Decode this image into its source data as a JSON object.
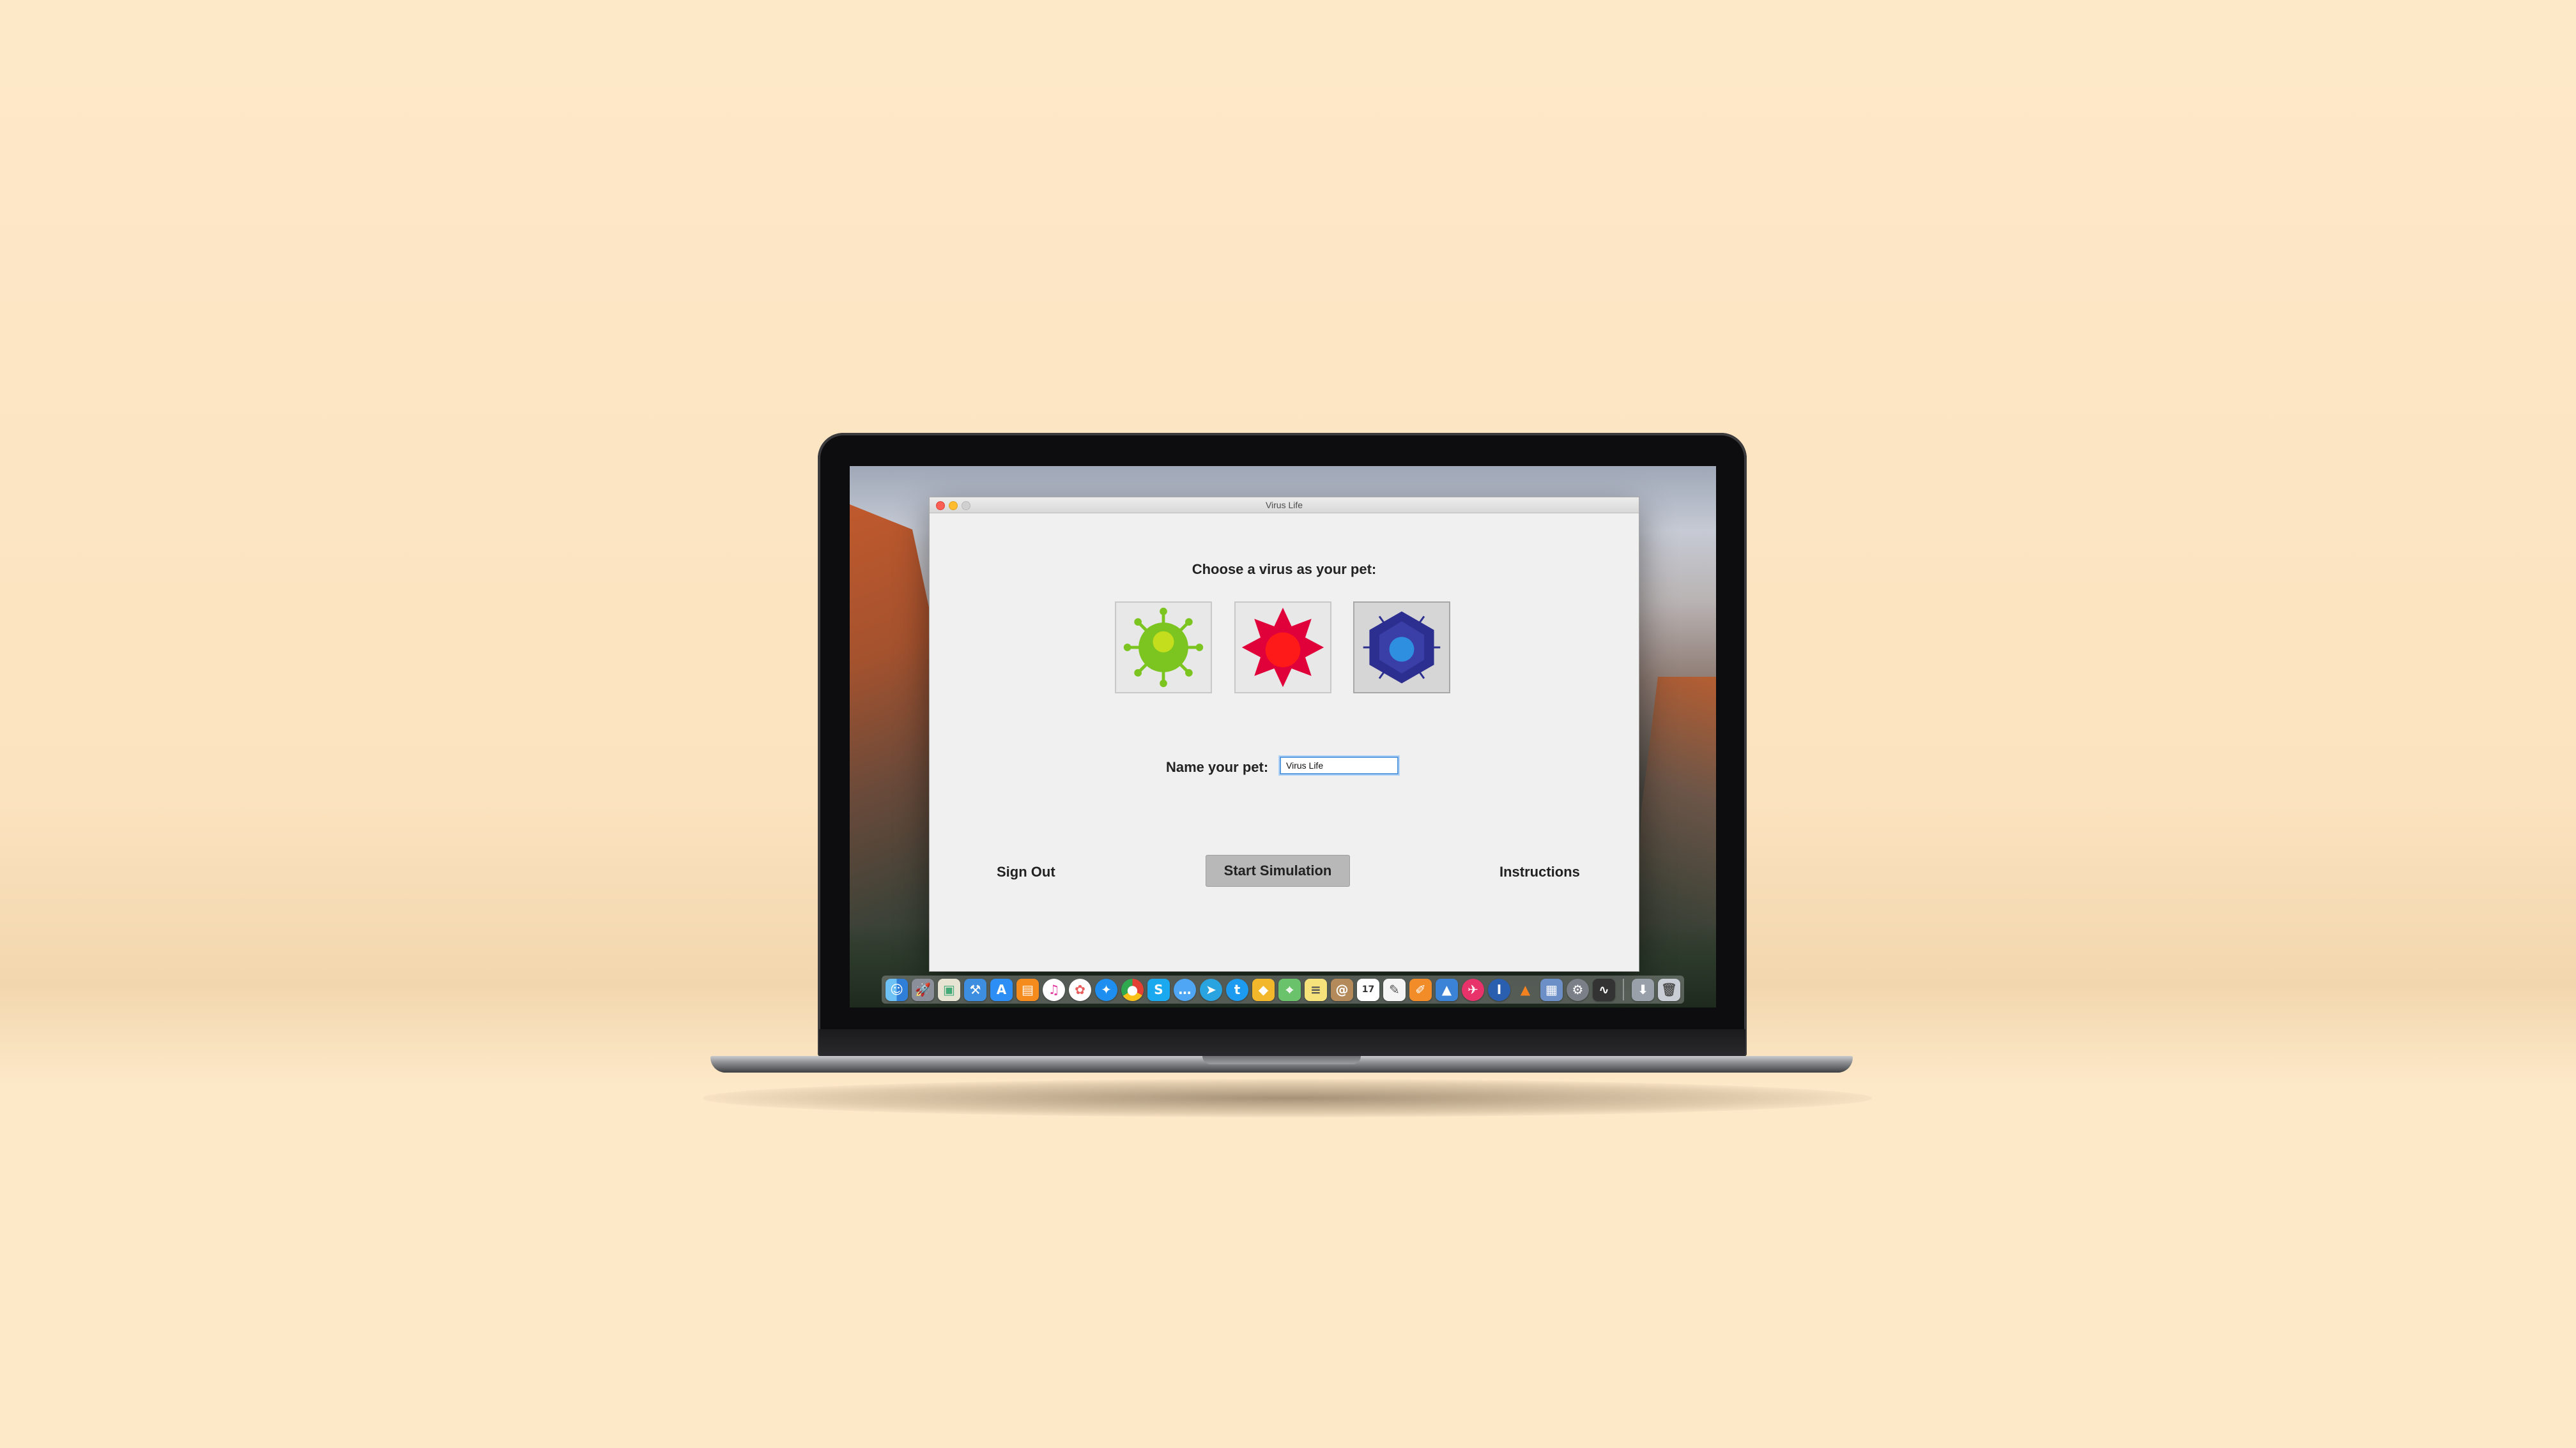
{
  "window": {
    "title": "Virus Life"
  },
  "chooser": {
    "prompt": "Choose a virus as your pet:",
    "options": [
      {
        "name": "green-virus",
        "color": "#7cc520",
        "accent": "#b9dc1a"
      },
      {
        "name": "red-virus",
        "color": "#e0003a",
        "accent": "#ff1a1a"
      },
      {
        "name": "blue-virus",
        "color": "#2c2f8f",
        "accent": "#2e8fe0"
      }
    ]
  },
  "name_field": {
    "label": "Name your pet:",
    "value": "Virus Life"
  },
  "actions": {
    "sign_out": "Sign Out",
    "start": "Start Simulation",
    "instructions": "Instructions"
  },
  "dock": {
    "icons": [
      "finder-icon",
      "launchpad-icon",
      "preview-icon",
      "xcode-icon",
      "app-store-icon",
      "ibooks-icon",
      "itunes-icon",
      "photos-icon",
      "safari-icon",
      "chrome-icon",
      "skype-icon",
      "messages-icon",
      "telegram-icon",
      "twitter-icon",
      "sketch-icon",
      "maps-icon",
      "notes-icon",
      "contacts-icon",
      "calendar-icon",
      "textedit-icon",
      "pages-icon",
      "keynote-icon",
      "airmail-icon",
      "1password-icon",
      "vlc-icon",
      "mission-control-icon",
      "system-preferences-icon",
      "activity-monitor-icon",
      "downloads-icon",
      "trash-icon"
    ],
    "calendar_day": "17"
  }
}
